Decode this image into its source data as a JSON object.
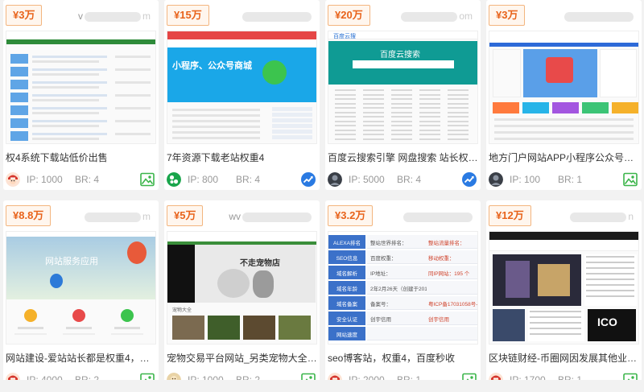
{
  "listings": [
    {
      "price": "¥3万",
      "domain_prefix": "v",
      "domain_suffix": "m",
      "title": "权4系统下载站低价出售",
      "ip_label": "IP: 1000",
      "br_label": "BR: 4",
      "trend_icon": "image-icon",
      "avatar_icon": "avatar-red-icon"
    },
    {
      "price": "¥15万",
      "domain_prefix": "",
      "domain_suffix": "",
      "title": "7年资源下载老站权重4",
      "ip_label": "IP: 800",
      "br_label": "BR: 4",
      "trend_icon": "trend-up-icon",
      "avatar_icon": "avatar-green-icon"
    },
    {
      "price": "¥20万",
      "domain_prefix": "",
      "domain_suffix": "om",
      "title": "百度云搜索引擎 网盘搜索 站长权4 移...",
      "ip_label": "IP: 5000",
      "br_label": "BR: 4",
      "trend_icon": "trend-up-icon",
      "avatar_icon": "avatar-dark-icon"
    },
    {
      "price": "¥3万",
      "domain_prefix": "",
      "domain_suffix": "",
      "title": "地方门户网站APP小程序公众号，适合...",
      "ip_label": "IP: 100",
      "br_label": "BR: 1",
      "trend_icon": "image-icon",
      "avatar_icon": "avatar-dark-icon"
    },
    {
      "price": "¥8.8万",
      "domain_prefix": "",
      "domain_suffix": "m",
      "title": "网站建设-爱站站长都是权重4，做站6...",
      "ip_label": "IP: 4000",
      "br_label": "BR: 2",
      "trend_icon": "image-icon",
      "avatar_icon": "avatar-red-icon"
    },
    {
      "price": "¥5万",
      "domain_prefix": "wv",
      "domain_suffix": "",
      "title": "宠物交易平台网站_另类宠物大全_奇异...",
      "ip_label": "IP: 1000",
      "br_label": "BR: 2",
      "trend_icon": "image-icon",
      "avatar_icon": "avatar-tan-icon"
    },
    {
      "price": "¥3.2万",
      "domain_prefix": "",
      "domain_suffix": "",
      "title": "seo博客站，权重4，百度秒收",
      "ip_label": "IP: 2000",
      "br_label": "BR: 1",
      "trend_icon": "image-icon",
      "avatar_icon": "avatar-red-icon"
    },
    {
      "price": "¥12万",
      "domain_prefix": "",
      "domain_suffix": "n",
      "title": "区块链财经-币圈网因发展其他业务转让",
      "ip_label": "IP: 1700",
      "br_label": "BR: 1",
      "trend_icon": "image-icon",
      "avatar_icon": "avatar-red-icon"
    }
  ],
  "thumb_text": {
    "c2_banner": "小程序、公众号商城",
    "c3_banner": "百度云搜索",
    "c3_logo": "百度云搜",
    "c5_banner": "网站服务应用",
    "c6_banner": "不走宠物店",
    "c6_foot": "宠物大全",
    "c7_rows": [
      {
        "label": "ALEXA排名",
        "v1": "整站世界排名：",
        "v2": "整站流量排名："
      },
      {
        "label": "SEO信息",
        "v1": "百度权重：",
        "v2": "移动权重："
      },
      {
        "label": "域名解析",
        "v1": "IP地址：",
        "v2": "同IP网站：195 个"
      },
      {
        "label": "域名年龄",
        "v1": "2年2月26天（创建于2017年05月24日,过"
      },
      {
        "label": "域名备案",
        "v1": "备案号：",
        "v2": "粤ICP备17031058号-1"
      },
      {
        "label": "安全认证",
        "v1": "创宇信用",
        "v2": "创宇信用"
      },
      {
        "label": "网站速度",
        "v1": "",
        "v2": ""
      }
    ],
    "c8_bottom": "ICO"
  },
  "colors": {
    "price_text": "#e8631b",
    "price_bg": "#fff6ee",
    "price_border": "#f3b57f",
    "trend_blue": "#2a7ae2",
    "image_green": "#3bb54a"
  }
}
